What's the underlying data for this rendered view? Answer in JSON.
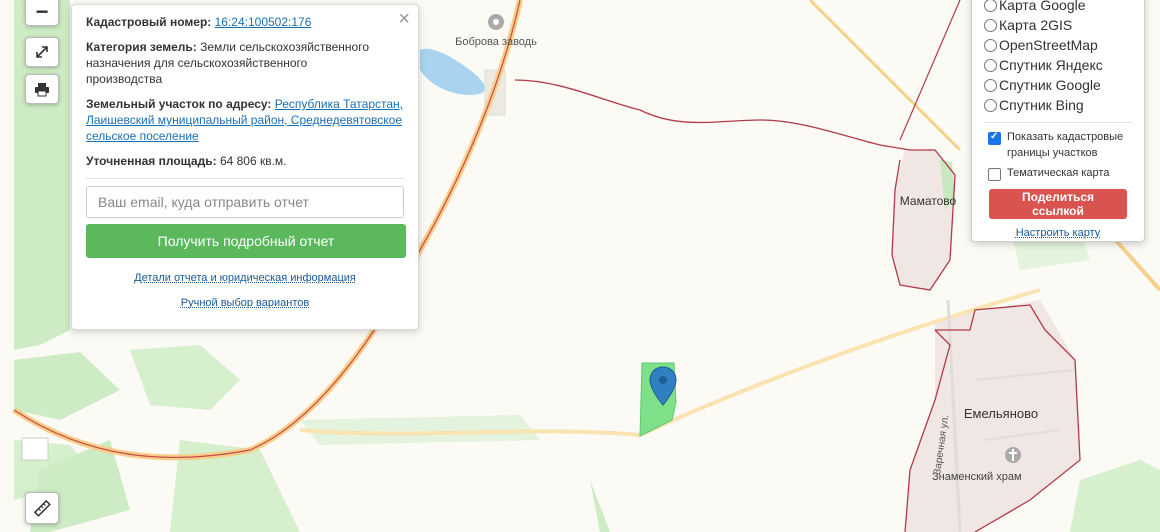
{
  "map": {
    "place_bobrovaya": "Боброва заводь",
    "place_mamatovo": "Маматово",
    "place_emelyanovo": "Емельяново",
    "place_znamensky": "Знаменский храм",
    "street_zarechnaya": "Заречная ул."
  },
  "controls": {
    "zoom_out": "−",
    "fullscreen_icon": "expand-icon",
    "print_icon": "printer-icon",
    "ruler_icon": "ruler-icon"
  },
  "popup": {
    "cadastral_label": "Кадастровый номер:",
    "cadastral_value": "16:24:100502:176",
    "category_label": "Категория земель:",
    "category_value": "Земли сельскохозяйственного назначения для сельскохозяйственного производства",
    "address_label": "Земельный участок по адресу:",
    "address_value": "Республика Татарстан, Лаишевский муниципальный район, Среднедевятовское сельское поселение",
    "area_label": "Уточненная площадь:",
    "area_value": "64 806 кв.м.",
    "email_placeholder": "Ваш email, куда отправить отчет",
    "report_button": "Получить подробный отчет",
    "details_link": "Детали отчета и юридическая информация",
    "manual_link": "Ручной выбор вариантов",
    "close": "×"
  },
  "layers": {
    "options": [
      "Карта Google",
      "Карта 2GIS",
      "OpenStreetMap",
      "Спутник Яндекс",
      "Спутник Google",
      "Спутник Bing"
    ],
    "show_cadastral": "Показать кадастровые границы участков",
    "show_cadastral_checked": true,
    "thematic": "Тематическая карта",
    "thematic_checked": false,
    "share_button": "Поделиться ссылкой",
    "setup_link": "Настроить карту"
  },
  "colors": {
    "accent_green": "#5cb85c",
    "accent_red": "#d9534f",
    "boundary": "#b23a48",
    "plot": "#7fe08a",
    "marker": "#2f7fc1"
  }
}
